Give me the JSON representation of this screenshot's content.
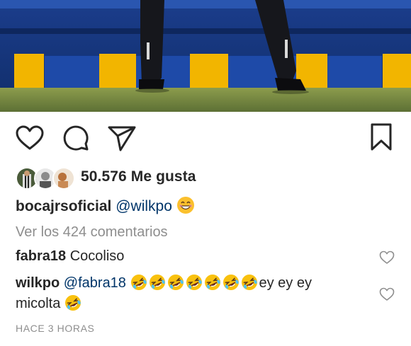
{
  "post": {
    "likes_text": "50.576 Me gusta",
    "caption": {
      "username": "bocajrsoficial",
      "mention": "@wilkpo",
      "emoji": "grinning-face-emoji"
    },
    "view_comments_label": "Ver los 424 comentarios",
    "comments": [
      {
        "username": "fabra18",
        "text": "Cocoliso"
      },
      {
        "username": "wilkpo",
        "mention": "@fabra18",
        "emoji": "rolling-on-floor-laughing-emoji",
        "emoji_count_line1": 7,
        "text_after": "ey ey ey",
        "line2": "micolta"
      }
    ],
    "timestamp": "HACE 3 HORAS"
  },
  "icons": {
    "like": "heart-outline-icon",
    "comment": "comment-bubble-icon",
    "share": "paper-plane-icon",
    "save": "bookmark-icon",
    "comment_like": "small-heart-icon"
  },
  "colors": {
    "text": "#262626",
    "secondary": "#8e8e8e",
    "mention": "#003569",
    "emoji_yellow": "#f9c10e"
  }
}
